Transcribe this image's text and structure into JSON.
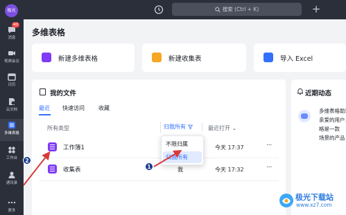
{
  "sidebar": {
    "avatar_text": "极光",
    "items": [
      {
        "label": "消息",
        "icon": "message-icon",
        "badge": "40"
      },
      {
        "label": "视频会议",
        "icon": "video-icon"
      },
      {
        "label": "日历",
        "icon": "calendar-icon"
      },
      {
        "label": "云文档",
        "icon": "cloud-doc-icon"
      },
      {
        "label": "多维表格",
        "icon": "bitable-icon"
      },
      {
        "label": "工作台",
        "icon": "workplace-icon"
      },
      {
        "label": "通讯录",
        "icon": "contacts-icon"
      },
      {
        "label": "更多",
        "icon": "more-icon"
      }
    ]
  },
  "topbar": {
    "search_placeholder": "搜索 (Ctrl + K)",
    "plus": "+"
  },
  "main": {
    "title": "多维表格",
    "cards": [
      {
        "label": "新建多维表格",
        "icon": "bitable-icon",
        "color": "#7f3bf5"
      },
      {
        "label": "新建收集表",
        "icon": "form-icon",
        "color": "#f5a623"
      },
      {
        "label": "导入 Excel",
        "icon": "import-icon",
        "color": "#3370ff"
      }
    ],
    "files": {
      "title": "我的文件",
      "tabs": [
        "最近",
        "快速访问",
        "收藏"
      ],
      "active_tab": "最近",
      "col_type": "所有类型",
      "col_owner_filter": "归我所有",
      "col_sort": "最近打开",
      "rows": [
        {
          "name": "工作簿1",
          "owner": "",
          "time": "今天 17:37"
        },
        {
          "name": "收集表",
          "owner": "我",
          "time": "今天 17:32"
        }
      ],
      "more": "···"
    },
    "dropdown": {
      "options": [
        "不限归属",
        "归我所有"
      ],
      "selected": "归我所有"
    },
    "recent": {
      "title": "近期动态",
      "messages": [
        "多维表格助理",
        "亲爱的用户，",
        "格是一款",
        "场景的产品"
      ]
    }
  },
  "annotations": {
    "badge_1": "1",
    "badge_2": "2",
    "arrow_color": "#d83a3a"
  },
  "watermark": {
    "text": "极光下载站",
    "url": "www.xz7.com"
  }
}
